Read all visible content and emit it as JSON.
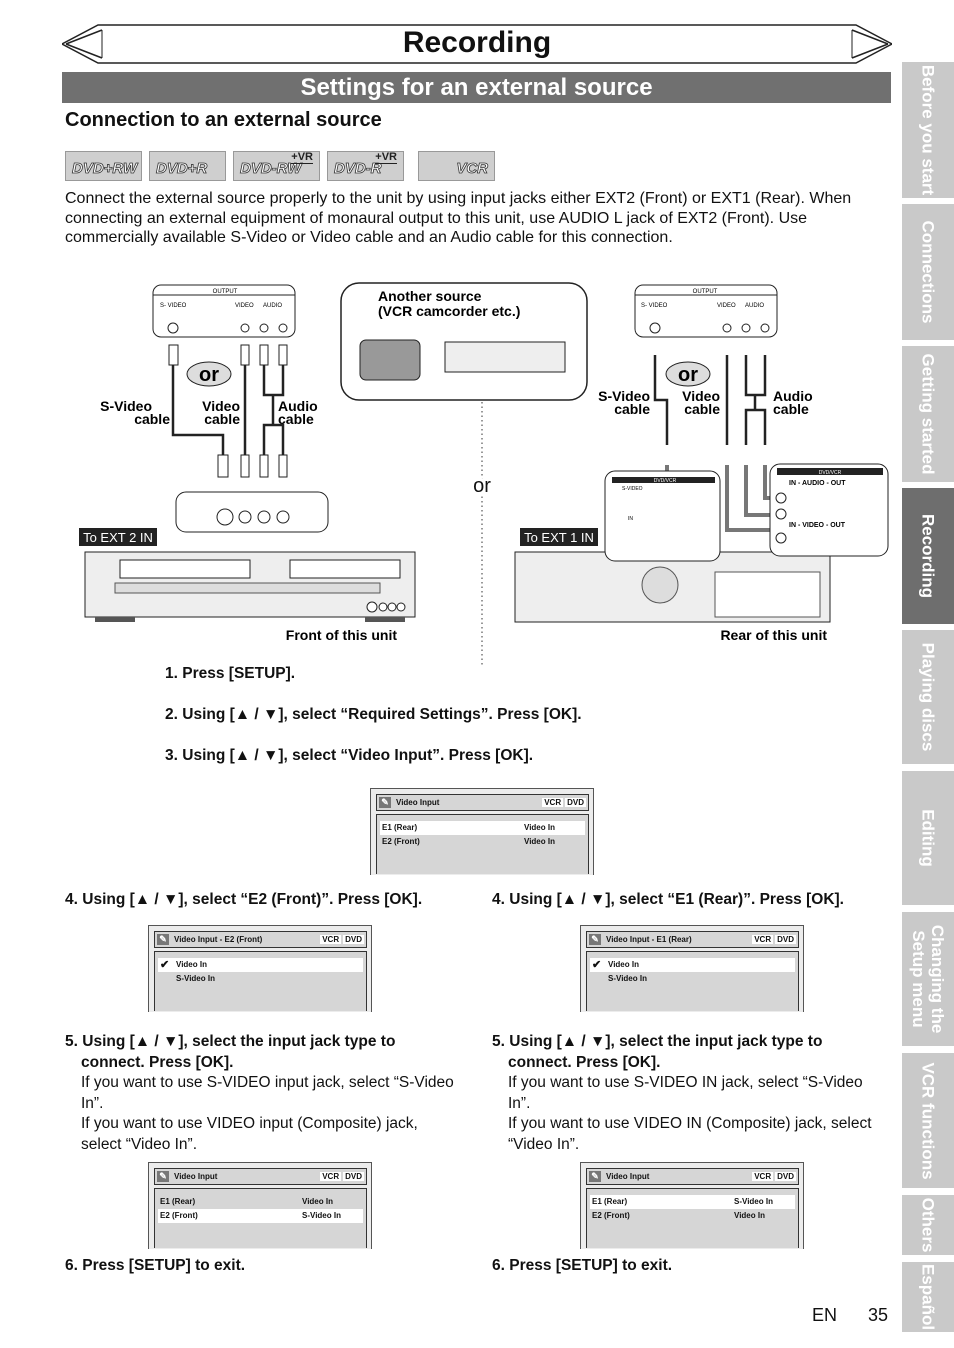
{
  "header": {
    "title": "Recording",
    "section": "Settings for an external source",
    "subheading": "Connection to an external source"
  },
  "badges": [
    {
      "label": "DVD+RW",
      "vr": ""
    },
    {
      "label": "DVD+R",
      "vr": ""
    },
    {
      "label": "DVD-RW",
      "vr": "+VR"
    },
    {
      "label": "DVD-R",
      "vr": "+VR"
    },
    {
      "label": "VCR",
      "vr": ""
    }
  ],
  "intro": "Connect the external source properly to the unit by using input jacks either EXT2 (Front) or EXT1 (Rear). When connecting an external equipment of monaural output to this unit, use AUDIO L jack of EXT2 (Front). Use commercially available S-Video or Video cable and an Audio cable for this connection.",
  "diagram": {
    "output": "OUTPUT",
    "s_video": "S- VIDEO",
    "video": "VIDEO",
    "audio": "AUDIO",
    "l": "L",
    "r": "R",
    "or_small": "or",
    "or_big": "or",
    "another_source_1": "Another source",
    "another_source_2": "(VCR camcorder etc.)",
    "s_video_cable_1": "S-Video",
    "video_cable_1": "Video",
    "audio_cable_1": "Audio",
    "cable": "cable",
    "to_ext2": "To EXT 2 IN",
    "to_ext1": "To EXT 1 IN",
    "front": "Front of this unit",
    "rear": "Rear of this unit",
    "dvd_vcr": "DVD/VCR",
    "in": "IN",
    "in_audio_out": "IN - AUDIO - OUT",
    "in_video_out": "IN - VIDEO - OUT",
    "s_video_jack": "S-VIDEO"
  },
  "steps": {
    "s1": "1.",
    "s1_text": "Press [SETUP].",
    "s2": "2.",
    "s2_text": "Using [▲ / ▼], select “Required Settings”. Press [OK].",
    "s3": "3.",
    "s3_text": "Using [▲ / ▼], select “Video Input”. Press [OK].",
    "left": {
      "s4": "4.",
      "s4_text": "Using [▲ / ▼], select “E2 (Front)”. Press [OK].",
      "s5": "5.",
      "s5_text": "Using [▲ / ▼], select the input jack type to connect. Press [OK].",
      "s5_p1": "If you want to use S-VIDEO input jack, select “S-Video In”.",
      "s5_p2": "If you want to use VIDEO input (Composite) jack, select “Video In”.",
      "s6": "6.",
      "s6_text": "Press [SETUP] to exit."
    },
    "right": {
      "s4": "4.",
      "s4_text": "Using [▲ / ▼], select “E1 (Rear)”. Press [OK].",
      "s5": "5.",
      "s5_text": "Using [▲ / ▼], select the input jack type to connect. Press [OK].",
      "s5_p1": "If you want to use S-VIDEO IN jack, select “S-Video In”.",
      "s5_p2": "If you want to use VIDEO IN (Composite) jack, select “Video In”.",
      "s6": "6.",
      "s6_text": "Press [SETUP] to exit."
    }
  },
  "screens": {
    "tags": [
      "VCR",
      "DVD"
    ],
    "main": {
      "title": "Video Input",
      "rows": [
        [
          "E1 (Rear)",
          "Video In"
        ],
        [
          "E2 (Front)",
          "Video In"
        ]
      ]
    },
    "e2": {
      "title": "Video Input - E2 (Front)",
      "rows": [
        "Video In",
        "S-Video In"
      ]
    },
    "e1": {
      "title": "Video Input - E1 (Rear)",
      "rows": [
        "Video In",
        "S-Video In"
      ]
    },
    "left_result": {
      "title": "Video Input",
      "rows": [
        [
          "E1 (Rear)",
          "Video In"
        ],
        [
          "E2 (Front)",
          "S-Video In"
        ]
      ]
    },
    "right_result": {
      "title": "Video Input",
      "rows": [
        [
          "E1 (Rear)",
          "S-Video In"
        ],
        [
          "E2 (Front)",
          "Video In"
        ]
      ]
    }
  },
  "sidebar": [
    {
      "label": "Before you start"
    },
    {
      "label": "Connections"
    },
    {
      "label": "Getting started"
    },
    {
      "label": "Recording",
      "active": true
    },
    {
      "label": "Playing discs"
    },
    {
      "label": "Editing"
    },
    {
      "label": "Changing the Setup menu"
    },
    {
      "label": "VCR functions"
    },
    {
      "label": "Others"
    },
    {
      "label": "Español"
    }
  ],
  "footer": {
    "lang": "EN",
    "page": "35"
  },
  "colors": {
    "section_bar": "#707070",
    "tab": "#c9c9c9",
    "tab_active": "#6e6e6e",
    "screen_bg": "#d6d6d6"
  }
}
